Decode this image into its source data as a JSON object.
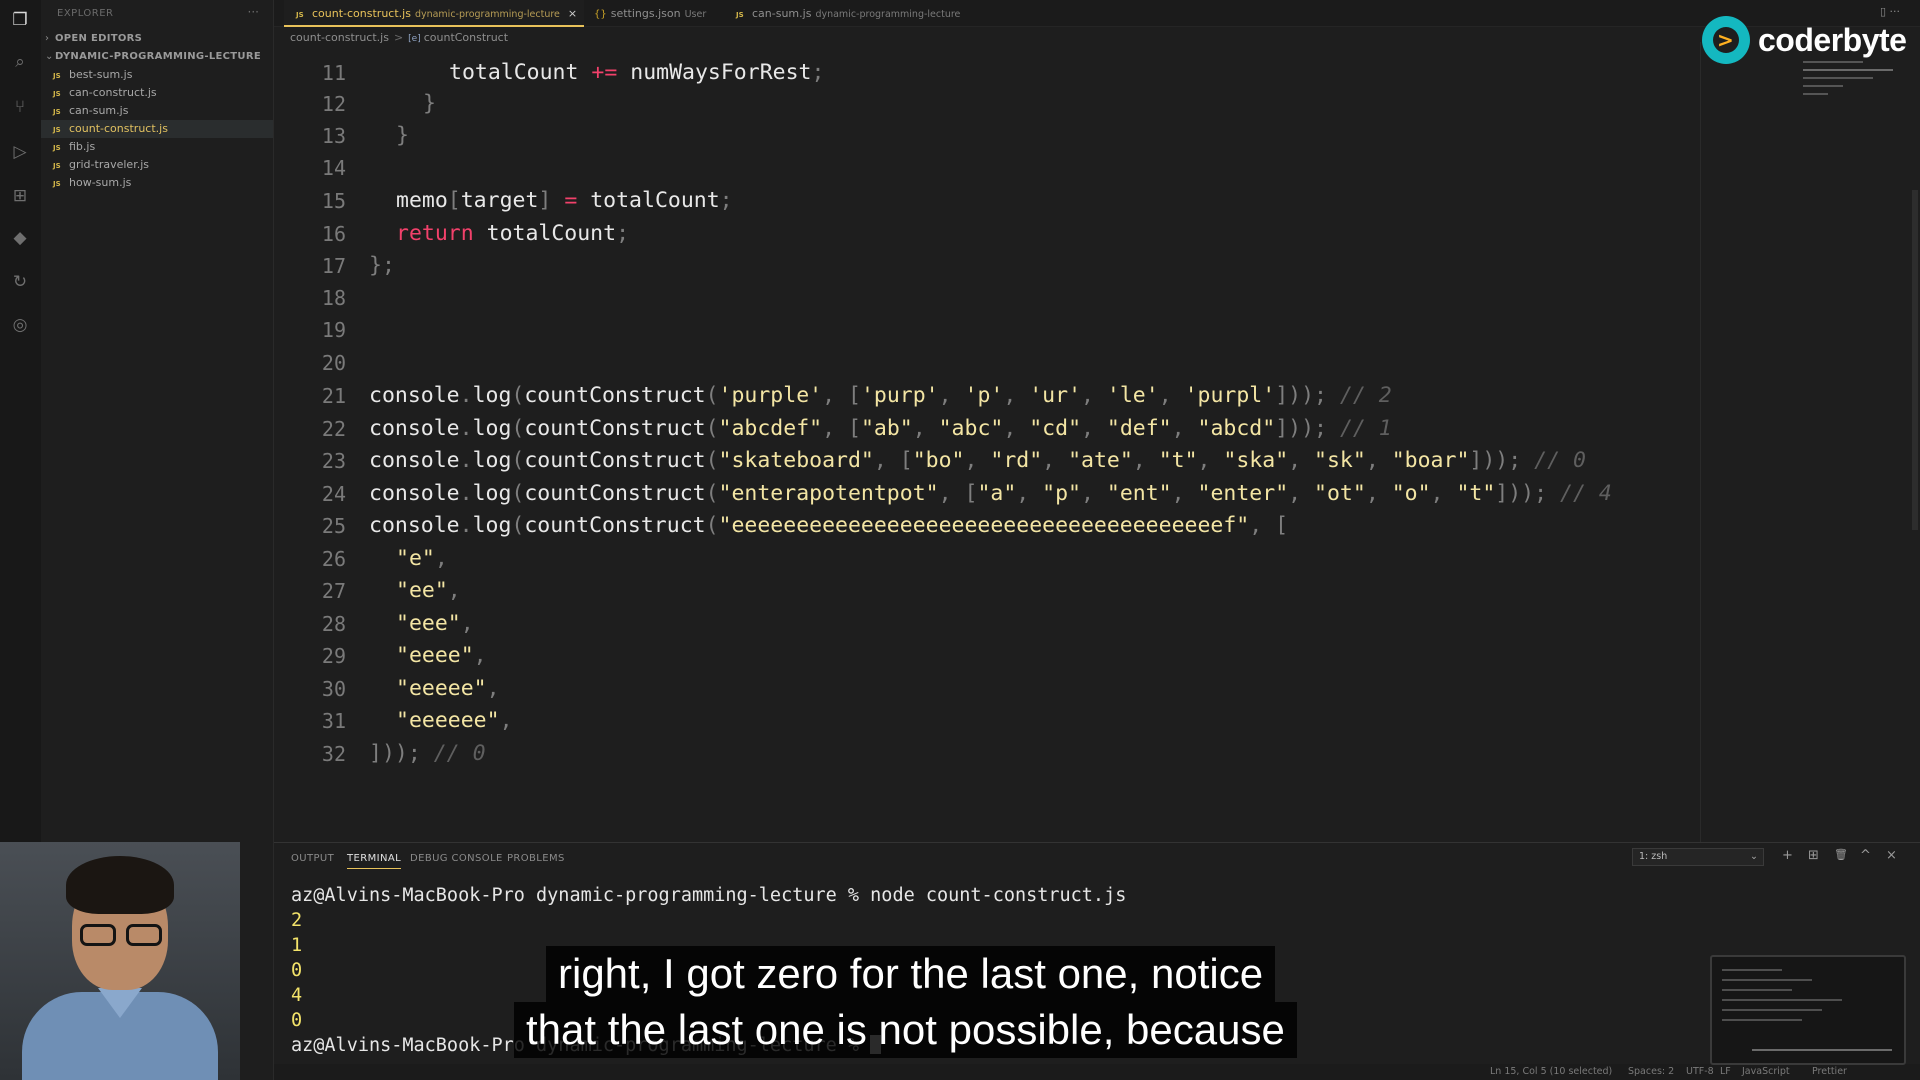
{
  "sidebar": {
    "header": "EXPLORER",
    "dots": "···",
    "open_editors": "OPEN EDITORS",
    "project": "DYNAMIC-PROGRAMMING-LECTURE",
    "files": [
      {
        "label": "best-sum.js",
        "badge": "JS"
      },
      {
        "label": "can-construct.js",
        "badge": "JS"
      },
      {
        "label": "can-sum.js",
        "badge": "JS"
      },
      {
        "label": "count-construct.js",
        "badge": "JS"
      },
      {
        "label": "fib.js",
        "badge": "JS"
      },
      {
        "label": "grid-traveler.js",
        "badge": "JS"
      },
      {
        "label": "how-sum.js",
        "badge": "JS"
      }
    ]
  },
  "tabs": [
    {
      "label": "count-construct.js",
      "desc": "dynamic-programming-lecture",
      "badge": "JS",
      "close": "×"
    },
    {
      "label": "settings.json",
      "desc": "User",
      "badge": "{}"
    },
    {
      "label": "can-sum.js",
      "desc": "dynamic-programming-lecture",
      "badge": "JS"
    }
  ],
  "breadcrumb": {
    "file": "count-construct.js",
    "separator": ">",
    "symbol": "[e]",
    "function": "countConstruct"
  },
  "logo": {
    "text": "coderbyte",
    "glyph": ">"
  },
  "code": {
    "line_numbers": [
      "11",
      "12",
      "13",
      "14",
      "15",
      "16",
      "17",
      "18",
      "19",
      "20",
      "21",
      "22",
      "23",
      "24",
      "25",
      "26",
      "27",
      "28",
      "29",
      "30",
      "31",
      "32"
    ],
    "l11": {
      "a": "totalCount",
      "op": "+=",
      "b": "numWaysForRest",
      "end": ";"
    },
    "l12": "}",
    "l13": "}",
    "l15": {
      "a": "memo",
      "br1": "[",
      "b": "target",
      "br2": "]",
      "op": "=",
      "c": "totalCount",
      "end": ";"
    },
    "l16": {
      "kw": "return",
      "a": "totalCount",
      "end": ";"
    },
    "l17": {
      "a": "}",
      "end": ";"
    },
    "calls": {
      "obj": "console",
      "dot": ".",
      "method": "log",
      "fn": "countConstruct"
    },
    "l21": {
      "target": "'purple'",
      "arr": [
        "'purp'",
        "'p'",
        "'ur'",
        "'le'",
        "'purpl'"
      ],
      "comment": "// 2"
    },
    "l22": {
      "target": "\"abcdef\"",
      "arr": [
        "\"ab\"",
        "\"abc\"",
        "\"cd\"",
        "\"def\"",
        "\"abcd\""
      ],
      "comment": "// 1"
    },
    "l23": {
      "target": "\"skateboard\"",
      "arr": [
        "\"bo\"",
        "\"rd\"",
        "\"ate\"",
        "\"t\"",
        "\"ska\"",
        "\"sk\"",
        "\"boar\""
      ],
      "comment": "// 0"
    },
    "l24": {
      "target": "\"enterapotentpot\"",
      "arr": [
        "\"a\"",
        "\"p\"",
        "\"ent\"",
        "\"enter\"",
        "\"ot\"",
        "\"o\"",
        "\"t\""
      ],
      "comment": "// 4"
    },
    "l25": {
      "target": "\"eeeeeeeeeeeeeeeeeeeeeeeeeeeeeeeeeeeeeef\"",
      "open": "["
    },
    "l26_31": [
      "\"e\"",
      "\"ee\"",
      "\"eee\"",
      "\"eeee\"",
      "\"eeeee\"",
      "\"eeeeee\""
    ],
    "l32": {
      "a": "]));",
      "comment": "// 0"
    }
  },
  "panel": {
    "tabs": [
      "OUTPUT",
      "TERMINAL",
      "DEBUG CONSOLE",
      "PROBLEMS"
    ],
    "shell": "1: zsh",
    "icons": {
      "add": "+",
      "split": "⊞",
      "trash": "🗑",
      "maximize": "^",
      "close": "×"
    },
    "prompt": "az@Alvins-MacBook-Pro dynamic-programming-lecture % node count-construct.js",
    "outputs": [
      "2",
      "1",
      "0",
      "4",
      "0"
    ],
    "prompt2": "az@Alvins-MacBook-Pro dynamic-programming-lecture % "
  },
  "status": {
    "position": "Ln 15, Col 5 (10 selected)",
    "spaces": "Spaces: 2",
    "encoding": "UTF-8",
    "eol": "LF",
    "language": "JavaScript",
    "prettier": "Prettier"
  },
  "subtitles": [
    "right, I got zero for the last one, notice",
    "that the last one is not possible, because"
  ]
}
